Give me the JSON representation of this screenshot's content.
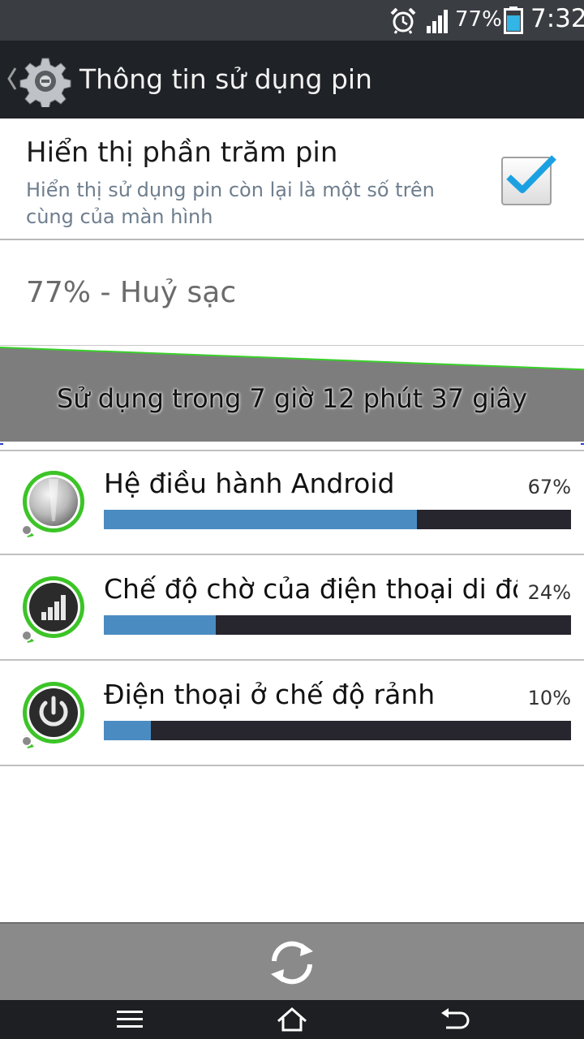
{
  "status_bar": {
    "battery_percent": "77%",
    "time": "7:32",
    "icons": [
      "alarm-clock-icon",
      "signal-strength-icon",
      "battery-icon"
    ]
  },
  "action_bar": {
    "title": "Thông tin sử dụng pin",
    "icons": [
      "back-chevron-icon",
      "settings-gear-icon"
    ]
  },
  "battery_percentage_pref": {
    "title": "Hiển thị phần trăm pin",
    "summary": "Hiển thị sử dụng pin còn lại là một số trên cùng của màn hình",
    "checked": true
  },
  "charge_status": "77% - Huỷ sạc",
  "graph": {
    "duration": "Sử dụng trong 7 giờ 12 phút 37 giây",
    "level_start": 1.0,
    "level_end": 0.77,
    "line_color": "#39d02a"
  },
  "usage_items": [
    {
      "name": "Hệ điều hành Android",
      "percent": "67%",
      "fraction": 0.67,
      "icon": "android-os-icon"
    },
    {
      "name": "Chế độ chờ của điện thoại di động",
      "percent": "24%",
      "fraction": 0.24,
      "icon": "cell-standby-icon"
    },
    {
      "name": "Điện thoại ở chế độ rảnh",
      "percent": "10%",
      "fraction": 0.1,
      "icon": "phone-idle-power-icon"
    }
  ],
  "bottom_bar": {
    "icon": "refresh-icon"
  },
  "nav_bar": {
    "icons": [
      "menu-icon",
      "home-icon",
      "back-icon"
    ]
  },
  "colors": {
    "bar_fill": "#4a8cc2",
    "bar_track": "#27252d",
    "checkbox_check": "#1ba1e2",
    "icon_ring": "#3cc427"
  }
}
